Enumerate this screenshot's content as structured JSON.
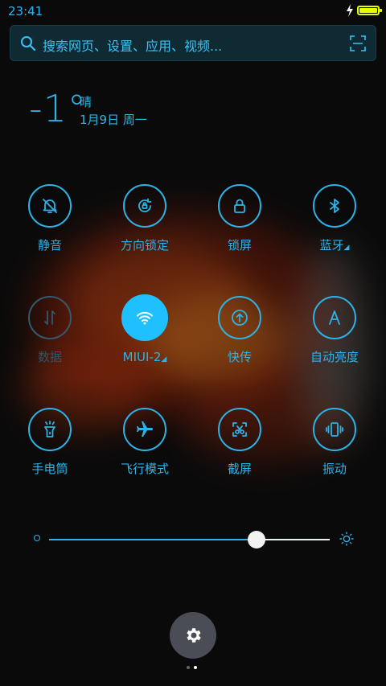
{
  "status": {
    "time": "23:41",
    "battery_level": 1.0,
    "charging": true
  },
  "search": {
    "placeholder": "搜索网页、设置、应用、视频..."
  },
  "weather": {
    "temp": "-1°",
    "condition": "晴",
    "date": "1月9日 周一"
  },
  "toggles": [
    {
      "label": "静音",
      "icon": "mute-bell-icon",
      "state": "off"
    },
    {
      "label": "方向锁定",
      "icon": "rotation-lock-icon",
      "state": "off"
    },
    {
      "label": "锁屏",
      "icon": "lock-icon",
      "state": "off"
    },
    {
      "label": "蓝牙",
      "icon": "bluetooth-icon",
      "state": "off",
      "has_menu": true
    },
    {
      "label": "数据",
      "icon": "mobile-data-icon",
      "state": "disabled"
    },
    {
      "label": "MIUI-2",
      "icon": "wifi-icon",
      "state": "on",
      "has_menu": true
    },
    {
      "label": "快传",
      "icon": "quick-transfer-icon",
      "state": "off"
    },
    {
      "label": "自动亮度",
      "icon": "auto-brightness-icon",
      "state": "off"
    },
    {
      "label": "手电筒",
      "icon": "flashlight-icon",
      "state": "off"
    },
    {
      "label": "飞行模式",
      "icon": "airplane-icon",
      "state": "off"
    },
    {
      "label": "截屏",
      "icon": "screenshot-icon",
      "state": "off"
    },
    {
      "label": "振动",
      "icon": "vibrate-icon",
      "state": "off"
    }
  ],
  "brightness": {
    "level": 0.74
  },
  "pager": {
    "pages": 2,
    "current": 2
  },
  "colors": {
    "accent": "#2bb3e8",
    "active": "#1ec0ff",
    "battery": "#e6ff00"
  }
}
